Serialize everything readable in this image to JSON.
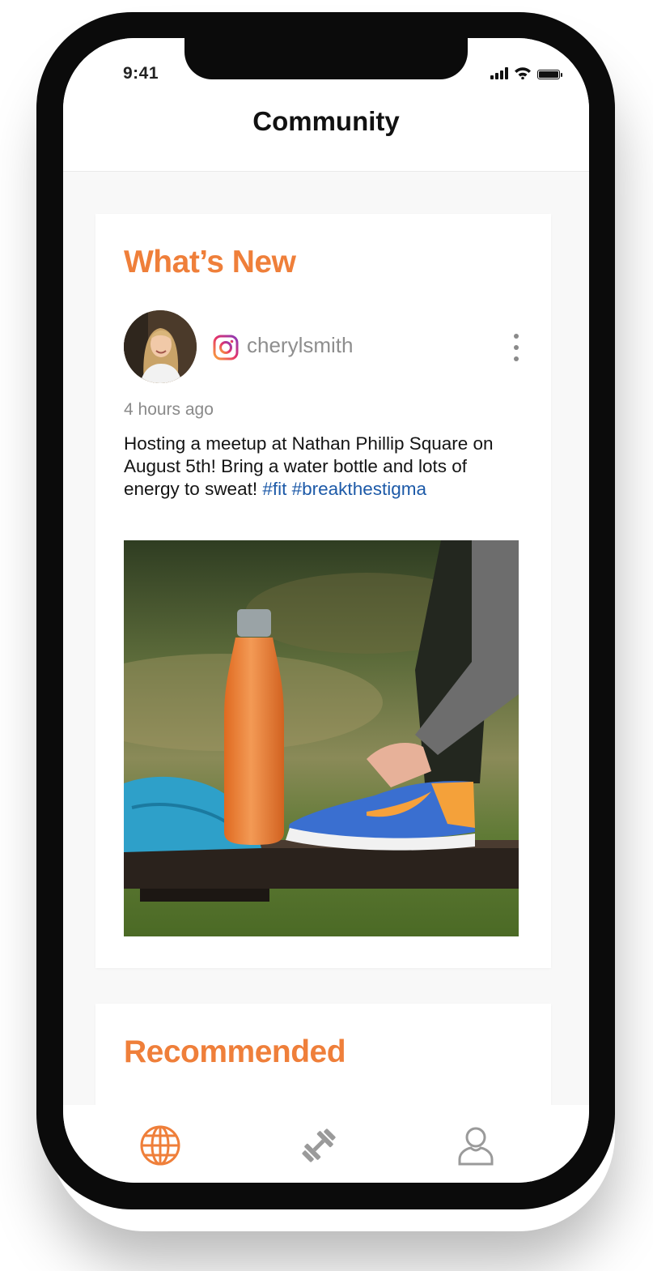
{
  "status_bar": {
    "time": "9:41"
  },
  "header": {
    "title": "Community"
  },
  "whats_new": {
    "section_title": "What’s New",
    "post": {
      "platform_icon": "instagram-icon",
      "username": "cherylsmith",
      "timestamp": "4 hours ago",
      "text": "Hosting a meetup at Nathan Phillip Square on August 5th! Bring a water bottle and lots of energy to sweat!",
      "hashtags": [
        "#fit",
        "#breakthestigma"
      ]
    }
  },
  "recommended": {
    "section_title": "Recommended"
  },
  "tab_bar": {
    "items": [
      {
        "icon": "globe-icon",
        "active": true
      },
      {
        "icon": "dumbbell-icon",
        "active": false
      },
      {
        "icon": "person-icon",
        "active": false
      }
    ]
  },
  "colors": {
    "accent": "#ef7f3a",
    "hashtag": "#1d5aa8",
    "inactive_icon": "#9a9a9a"
  }
}
